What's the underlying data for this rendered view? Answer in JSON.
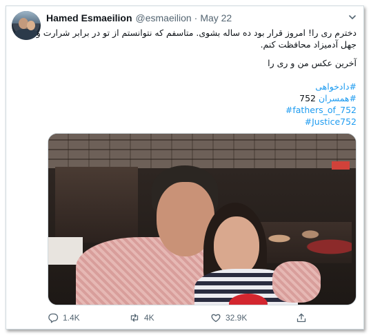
{
  "tweet": {
    "author_name": "Hamed Esmaeilion",
    "handle": "@esmaeilion",
    "separator": "·",
    "date": "May 22",
    "paragraph1": "دخترم ری را! امروز قرار بود ده ساله بشوی. متاسفم که نتوانستم از تو در برابر شرارت و جهل آدمیزاد محافظت کنم.",
    "paragraph2": "آخرین عکس من و ری را",
    "hashtags": {
      "tag1": "#دادخواهی",
      "tag2_prefix": "#همسران",
      "tag2_number": "752",
      "tag3": "#fathers_of_752",
      "tag4": "#Justice752"
    }
  },
  "actions": {
    "reply_count": "1.4K",
    "retweet_count": "4K",
    "like_count": "32.9K"
  },
  "icons": {
    "menu": "chevron-down-icon",
    "reply": "reply-icon",
    "retweet": "retweet-icon",
    "like": "heart-icon",
    "share": "share-icon"
  },
  "colors": {
    "link": "#1d9bf0",
    "muted": "#536471",
    "text": "#0f1419",
    "border": "#cfd9de"
  }
}
